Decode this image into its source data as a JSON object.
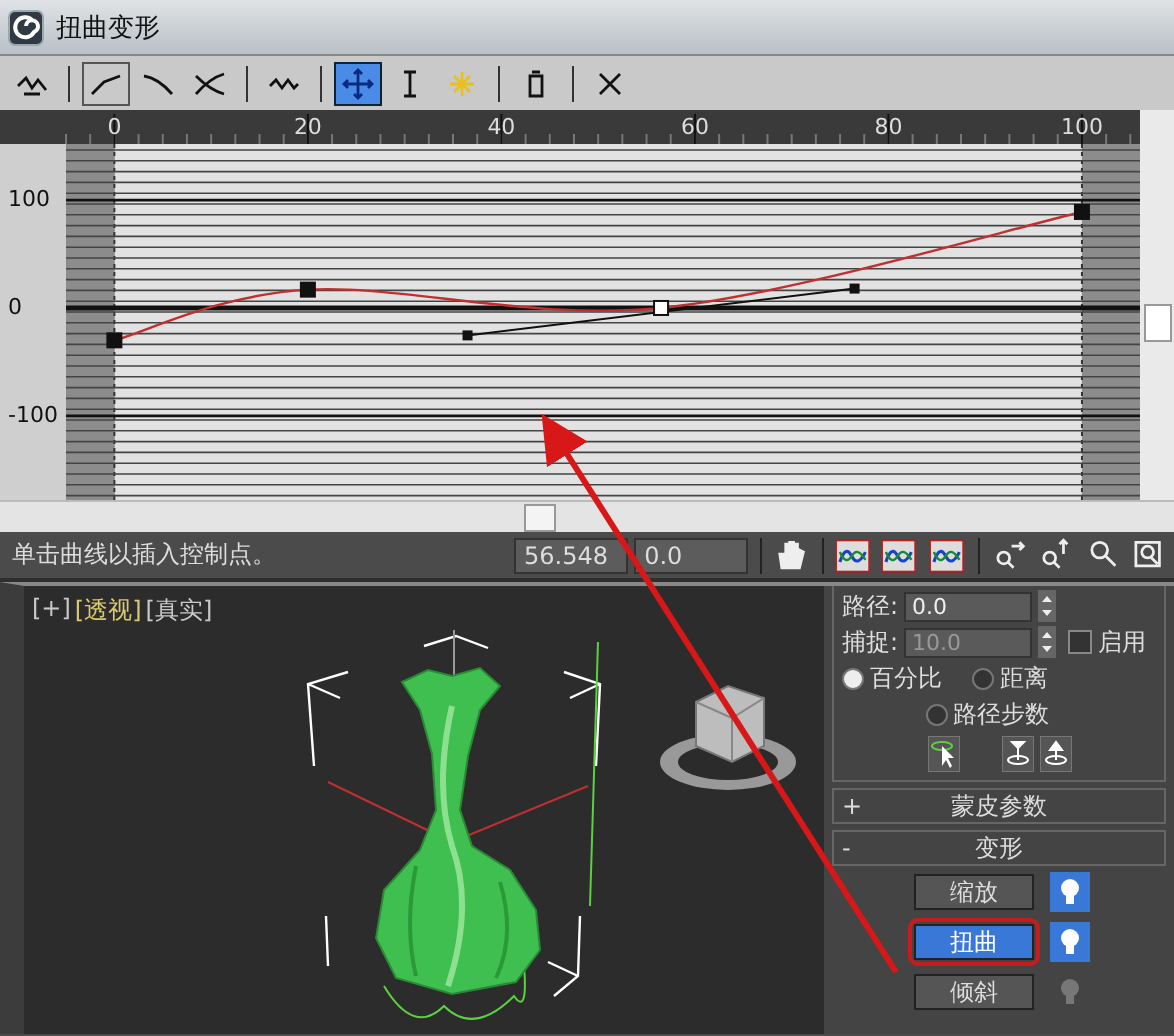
{
  "window": {
    "title": "扭曲变形"
  },
  "toolbar": [
    {
      "selected": false
    },
    {
      "selected": true
    },
    {
      "selected": false
    },
    {
      "selected": false
    },
    {
      "selected": false
    },
    {
      "selected": true
    },
    {
      "selected": false
    },
    {
      "selected": false
    },
    {
      "selected": false
    },
    {
      "selected": false
    }
  ],
  "graph": {
    "chart_data": {
      "type": "line",
      "x": [
        0,
        20,
        56.5,
        100
      ],
      "values": [
        -30,
        17,
        0,
        89
      ],
      "xlim": [
        -5,
        106
      ],
      "ylim": [
        -178,
        152
      ],
      "xticks": [
        0,
        20,
        40,
        60,
        80,
        100
      ],
      "yticks": [
        -100,
        0,
        100
      ],
      "grid": true,
      "marker": "square"
    },
    "curve_points": [
      {
        "selected": false
      },
      {
        "selected": false
      },
      {
        "selected": true
      },
      {
        "selected": false
      }
    ]
  },
  "status_bar": {
    "prompt": "单击曲线以插入控制点。",
    "x_value": "56.548",
    "y_value": "0.0"
  },
  "viewport": {
    "labels": [
      {
        "text": "[+]",
        "highlighted": false
      },
      {
        "text": "[透视]",
        "highlighted": true
      },
      {
        "text": "[真实]",
        "highlighted": false
      }
    ]
  },
  "path_params": {
    "fields": [
      {
        "label": "路径:",
        "value": "0.0",
        "disabled": false
      },
      {
        "label": "捕捉:",
        "value": "10.0",
        "disabled": true
      }
    ],
    "enable_checkbox": {
      "label": "启用",
      "checked": false
    },
    "radios": [
      {
        "label": "百分比",
        "selected": true
      },
      {
        "label": "距离",
        "selected": false
      },
      {
        "label": "路径步数",
        "selected": false
      }
    ]
  },
  "rollouts": [
    {
      "toggle": "+",
      "title": "蒙皮参数"
    },
    {
      "toggle": "-",
      "title": "变形"
    }
  ],
  "deform_buttons": [
    {
      "label": "缩放",
      "selected": false,
      "toggle_on": true,
      "highlighted": false
    },
    {
      "label": "扭曲",
      "selected": true,
      "toggle_on": true,
      "highlighted": true
    },
    {
      "label": "倾斜",
      "selected": false,
      "toggle_on": false,
      "highlighted": false
    }
  ]
}
